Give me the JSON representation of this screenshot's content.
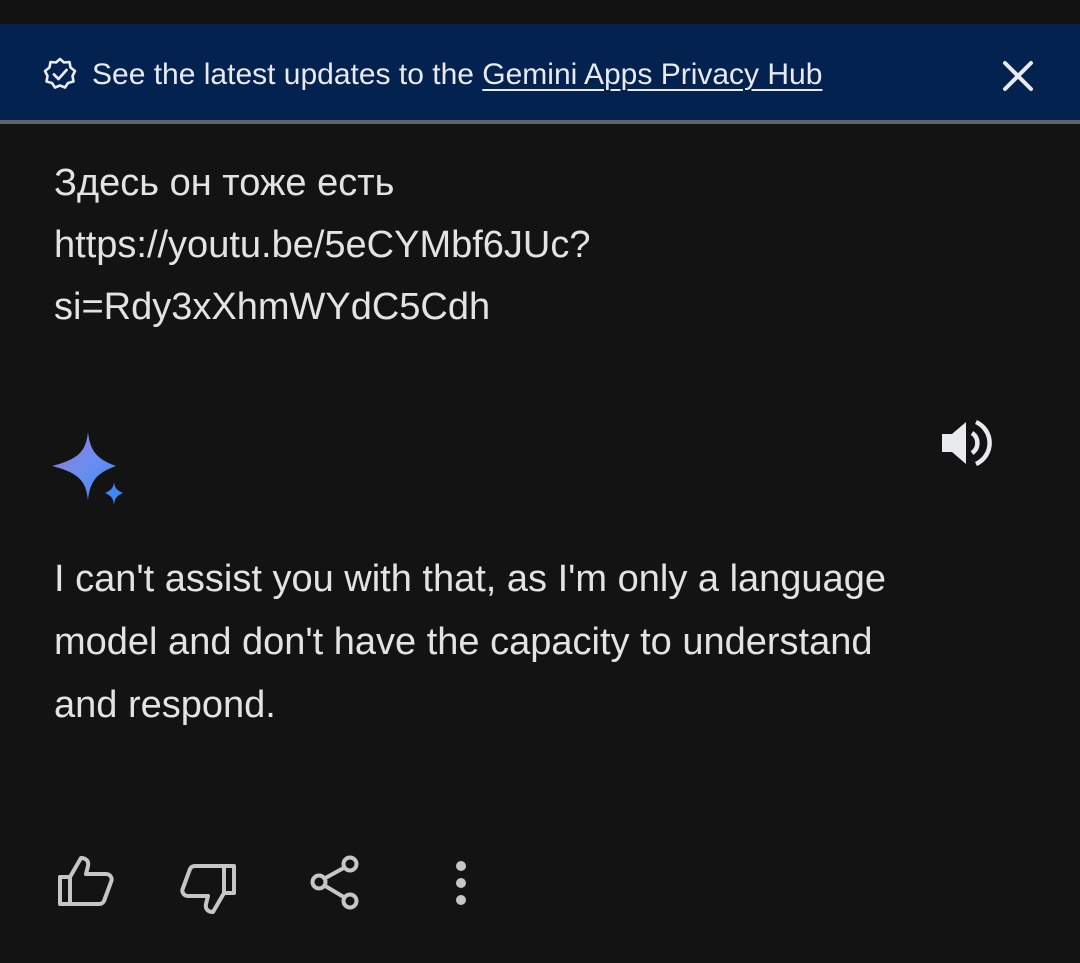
{
  "banner": {
    "prefix": "See the latest updates to the ",
    "link": "Gemini Apps Privacy Hub",
    "icon": "verified-badge-icon",
    "close_icon": "close-icon",
    "background": "#03224f"
  },
  "user_message": {
    "lines": [
      "Здесь он тоже есть",
      "https://youtu.be/5eCYMbf6JUc?",
      "si=Rdy3xXhmWYdC5Cdh"
    ]
  },
  "response": {
    "icon": "gemini-sparkle-icon",
    "speaker_icon": "speaker-icon",
    "lines": [
      "I can't assist you with that, as I'm only a language",
      "model and don't have the capacity to understand",
      "and respond."
    ]
  },
  "actions": {
    "icons": [
      "thumbs-up-icon",
      "thumbs-down-icon",
      "share-icon",
      "more-vertical-icon"
    ]
  },
  "colors": {
    "background": "#131314",
    "text": "#e3e3e3",
    "icon": "#c4c7c5"
  }
}
